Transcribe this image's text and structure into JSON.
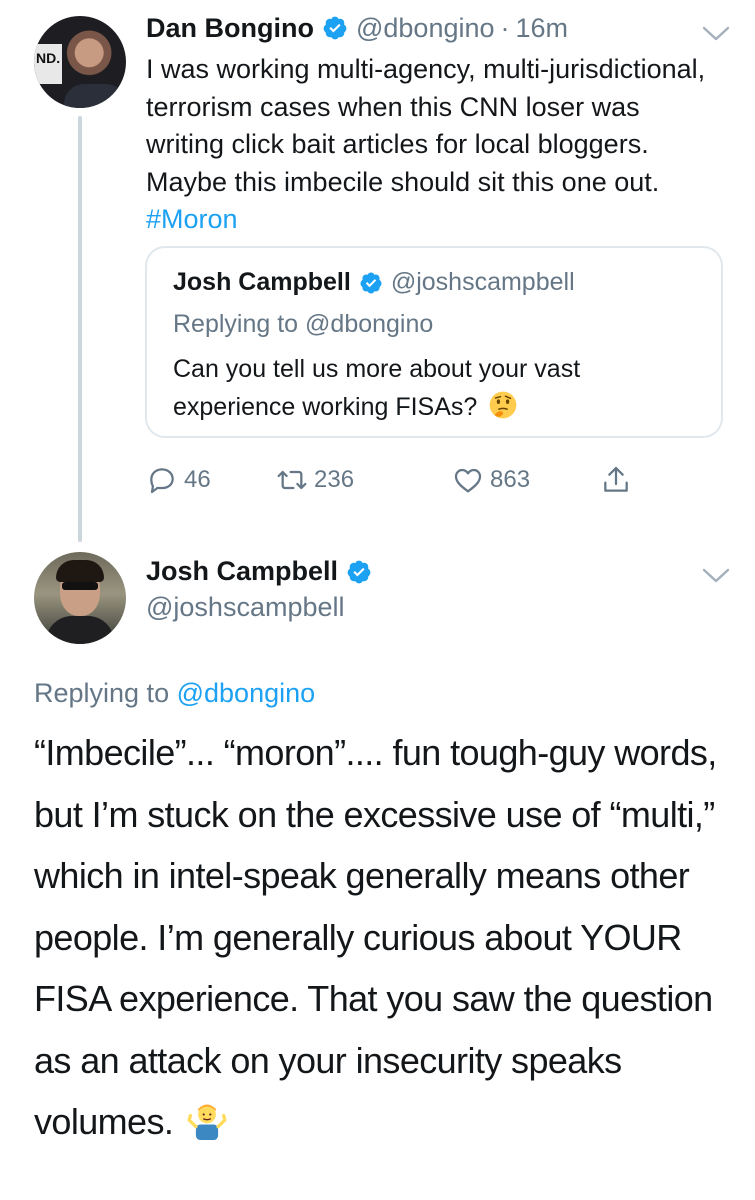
{
  "colors": {
    "link": "#1da1f2",
    "secondary_text": "#657786",
    "primary_text": "#14171a",
    "border": "#e1e8ed"
  },
  "tweet1": {
    "author_name": "Dan Bongino",
    "handle": "@dbongino",
    "separator": "·",
    "time": "16m",
    "text": "I was working multi-agency, multi-jurisdictional, terrorism cases when this CNN loser was writing click bait articles for local bloggers. Maybe this imbecile should sit this one out.",
    "hashtag": "#Moron",
    "avatar_label": "ND.",
    "icons": {
      "verified": "verified-badge-icon",
      "menu": "chevron-down-icon"
    },
    "quoted": {
      "author_name": "Josh Campbell",
      "handle": "@joshscampbell",
      "replying_prefix": "Replying to",
      "replying_to": "@dbongino",
      "text": "Can you tell us more about your vast experience working FISAs?",
      "emoji": "thinking-face-emoji"
    },
    "actions": {
      "replies": "46",
      "retweets": "236",
      "likes": "863",
      "icons": [
        "reply-icon",
        "retweet-icon",
        "like-icon",
        "share-icon"
      ]
    }
  },
  "tweet2": {
    "author_name": "Josh Campbell",
    "handle": "@joshscampbell",
    "replying_prefix": "Replying to",
    "replying_to": "@dbongino",
    "text": "“Imbecile”... “moron”.... fun tough-guy words, but I’m stuck on the excessive use of “multi,” which in intel-speak generally means other people. I’m generally curious about YOUR FISA experience. That you saw the question as an attack on your insecurity speaks volumes.",
    "emoji": "man-shrugging-emoji"
  }
}
